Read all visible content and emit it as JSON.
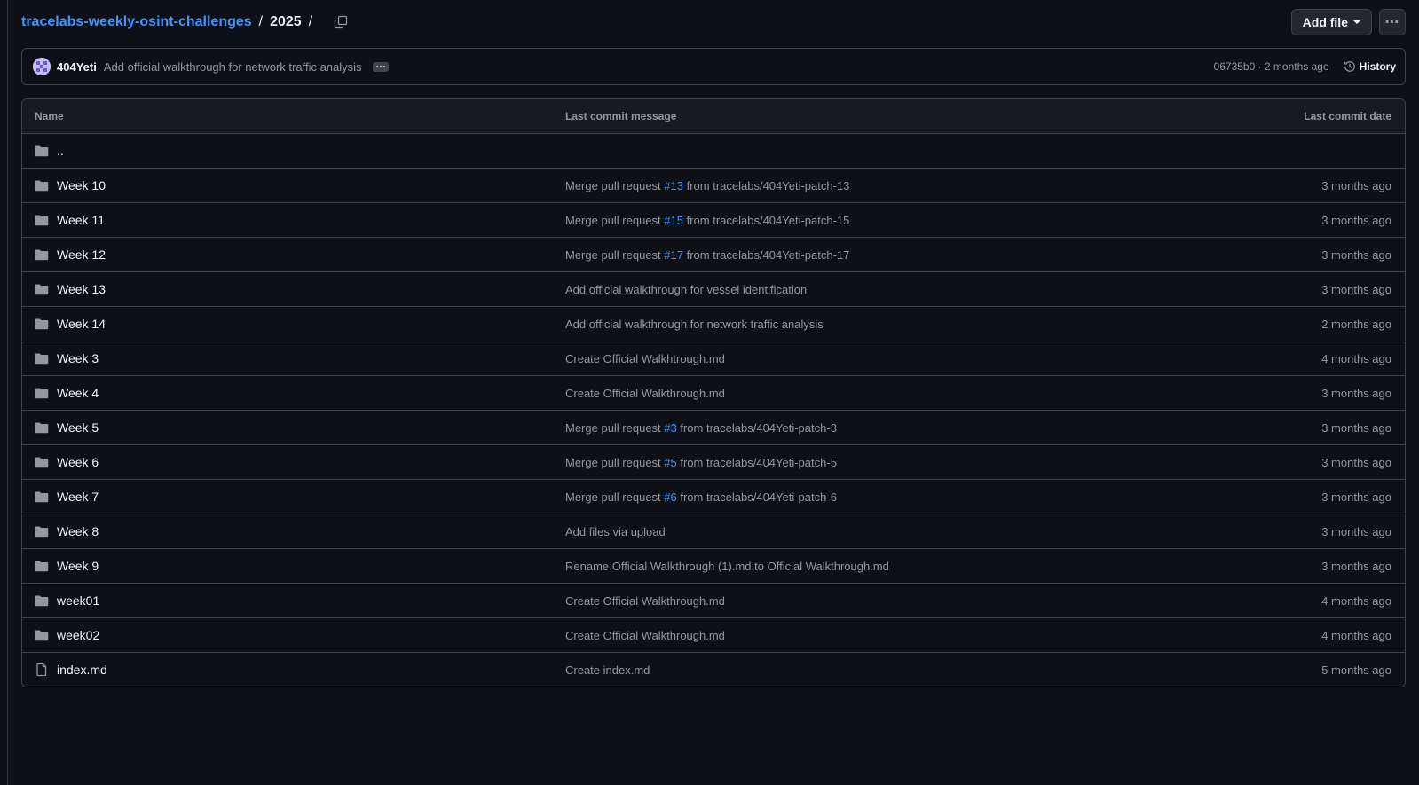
{
  "breadcrumb": {
    "repo": "tracelabs-weekly-osint-challenges",
    "separator": "/",
    "current": "2025",
    "trailing_separator": "/"
  },
  "actions": {
    "add_file_label": "Add file",
    "more_label": "⋯"
  },
  "latest_commit": {
    "author": "404Yeti",
    "message": "Add official walkthrough for network traffic analysis",
    "hash_and_time": "06735b0 · 2 months ago",
    "history_label": "History"
  },
  "table": {
    "headers": {
      "name": "Name",
      "message": "Last commit message",
      "date": "Last commit date"
    },
    "parent": "..",
    "rows": [
      {
        "name": "Week 10",
        "type": "dir",
        "msg_pre": "Merge pull request ",
        "pr": "#13",
        "msg_post": " from tracelabs/404Yeti-patch-13",
        "date": "3 months ago"
      },
      {
        "name": "Week 11",
        "type": "dir",
        "msg_pre": "Merge pull request ",
        "pr": "#15",
        "msg_post": " from tracelabs/404Yeti-patch-15",
        "date": "3 months ago"
      },
      {
        "name": "Week 12",
        "type": "dir",
        "msg_pre": "Merge pull request ",
        "pr": "#17",
        "msg_post": " from tracelabs/404Yeti-patch-17",
        "date": "3 months ago"
      },
      {
        "name": "Week 13",
        "type": "dir",
        "msg_pre": "Add official walkthrough for vessel identification",
        "pr": "",
        "msg_post": "",
        "date": "3 months ago"
      },
      {
        "name": "Week 14",
        "type": "dir",
        "msg_pre": "Add official walkthrough for network traffic analysis",
        "pr": "",
        "msg_post": "",
        "date": "2 months ago"
      },
      {
        "name": "Week 3",
        "type": "dir",
        "msg_pre": "Create Official Walkhtrough.md",
        "pr": "",
        "msg_post": "",
        "date": "4 months ago"
      },
      {
        "name": "Week 4",
        "type": "dir",
        "msg_pre": "Create Official Walkthrough.md",
        "pr": "",
        "msg_post": "",
        "date": "3 months ago"
      },
      {
        "name": "Week 5",
        "type": "dir",
        "msg_pre": "Merge pull request ",
        "pr": "#3",
        "msg_post": " from tracelabs/404Yeti-patch-3",
        "date": "3 months ago"
      },
      {
        "name": "Week 6",
        "type": "dir",
        "msg_pre": "Merge pull request ",
        "pr": "#5",
        "msg_post": " from tracelabs/404Yeti-patch-5",
        "date": "3 months ago"
      },
      {
        "name": "Week 7",
        "type": "dir",
        "msg_pre": "Merge pull request ",
        "pr": "#6",
        "msg_post": " from tracelabs/404Yeti-patch-6",
        "date": "3 months ago"
      },
      {
        "name": "Week 8",
        "type": "dir",
        "msg_pre": "Add files via upload",
        "pr": "",
        "msg_post": "",
        "date": "3 months ago"
      },
      {
        "name": "Week 9",
        "type": "dir",
        "msg_pre": "Rename Official Walkthrough (1).md to Official Walkthrough.md",
        "pr": "",
        "msg_post": "",
        "date": "3 months ago"
      },
      {
        "name": "week01",
        "type": "dir",
        "msg_pre": "Create Official Walkthrough.md",
        "pr": "",
        "msg_post": "",
        "date": "4 months ago"
      },
      {
        "name": "week02",
        "type": "dir",
        "msg_pre": "Create Official Walkthrough.md",
        "pr": "",
        "msg_post": "",
        "date": "4 months ago"
      },
      {
        "name": "index.md",
        "type": "file",
        "msg_pre": "Create index.md",
        "pr": "",
        "msg_post": "",
        "date": "5 months ago"
      }
    ]
  },
  "colors": {
    "background": "#0d1117",
    "link": "#4493f8",
    "border": "#3d444d",
    "muted_text": "#9198a1"
  }
}
